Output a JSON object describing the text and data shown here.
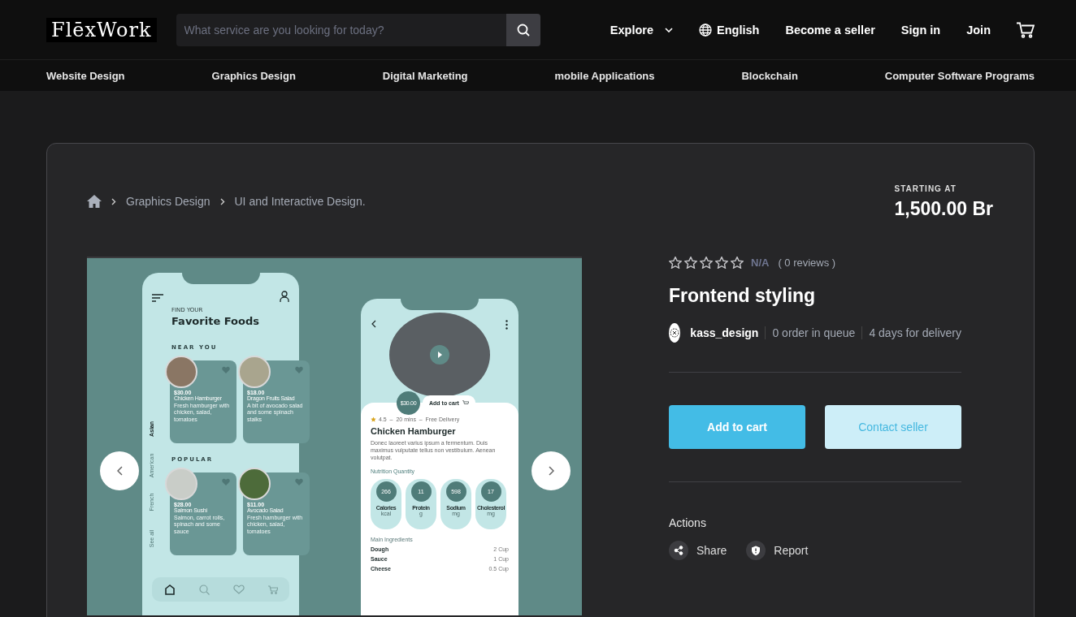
{
  "header": {
    "logo": "FlēxWork",
    "search": {
      "placeholder": "What service are you looking for today?"
    },
    "nav": [
      {
        "label": "Explore",
        "kind": "dropdown"
      },
      {
        "label": "English",
        "kind": "language"
      },
      {
        "label": "Become a seller",
        "kind": "link"
      },
      {
        "label": "Sign in",
        "kind": "link"
      },
      {
        "label": "Join",
        "kind": "link"
      }
    ]
  },
  "categories": [
    "Website Design",
    "Graphics Design",
    "Digital Marketing",
    "mobile Applications",
    "Blockchain",
    "Computer Software Programs"
  ],
  "gig": {
    "breadcrumb": [
      "Graphics Design",
      "UI and Interactive Design."
    ],
    "price_label": "STARTING AT",
    "price": "1,500.00 Br",
    "gallery": {
      "list_screen": {
        "kicker": "FIND YOUR",
        "title": "Favorite Foods",
        "categories": [
          {
            "label": "See all",
            "selected": false
          },
          {
            "label": "French",
            "selected": false
          },
          {
            "label": "American",
            "selected": false
          },
          {
            "label": "Asian",
            "selected": true
          }
        ],
        "sections": [
          {
            "heading": "NEAR YOU",
            "items": [
              {
                "price": "$30.00",
                "name": "Chicken Hamburger",
                "desc": "Fresh hamburger with chicken, salad, tomatoes"
              },
              {
                "price": "$18.00",
                "name": "Dragon Fruits Salad",
                "desc": "A bit of avocado salad and some spinach stalks"
              }
            ]
          },
          {
            "heading": "POPULAR",
            "items": [
              {
                "price": "$28.00",
                "name": "Salmon Sushi",
                "desc": "Salmon, carrot rolls, spinach and some sauce"
              },
              {
                "price": "$11.00",
                "name": "Avocado Salad",
                "desc": "Fresh hamburger with chicken, salad, tomatoes"
              }
            ]
          }
        ]
      },
      "detail_screen": {
        "price": "$30.00",
        "cart_label": "Add to cart",
        "meta": "4.5  –  20 mins  –  Free Delivery",
        "title": "Chicken Hamburger",
        "description": "Donec laoreet varius ipsum a fermentum. Duis maximus vulputate tellus non vestibulum. Aenean volutpat.",
        "nutrition_title": "Nutrition Quantity",
        "nutrition": [
          {
            "value": "266",
            "label": "Calories",
            "unit": "kcal"
          },
          {
            "value": "11",
            "label": "Protein",
            "unit": "g"
          },
          {
            "value": "598",
            "label": "Sodium",
            "unit": "mg"
          },
          {
            "value": "17",
            "label": "Cholesterol",
            "unit": "mg"
          }
        ],
        "ingredients_title": "Main Ingredients",
        "ingredients": [
          {
            "name": "Dough",
            "amount": "2 Cup"
          },
          {
            "name": "Sauce",
            "amount": "1 Cup"
          },
          {
            "name": "Cheese",
            "amount": "0.5 Cup"
          }
        ]
      }
    },
    "stars": 0,
    "rating": "N/A",
    "reviews": "( 0 reviews )",
    "title": "Frontend styling",
    "seller": {
      "name": "kass_design",
      "queue": "0 order in queue",
      "delivery": "4 days for delivery"
    },
    "buttons": [
      {
        "label": "Add to cart",
        "kind": "primary"
      },
      {
        "label": "Contact seller",
        "kind": "secondary"
      }
    ],
    "actions_title": "Actions",
    "actions": [
      {
        "label": "Share",
        "kind": "share"
      },
      {
        "label": "Report",
        "kind": "report"
      }
    ]
  }
}
